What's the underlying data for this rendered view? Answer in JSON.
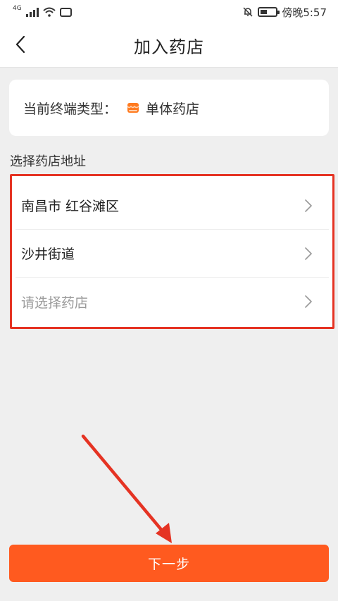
{
  "status_bar": {
    "network_label": "4G",
    "time_text": "傍晚5:57",
    "battery_level": 0.45,
    "icons": [
      "signal-icon",
      "wifi-icon",
      "app-notification-icon",
      "bell-off-icon",
      "battery-icon"
    ]
  },
  "nav": {
    "title": "加入药店",
    "back_icon": "chevron-left-icon"
  },
  "terminal_type": {
    "label": "当前终端类型：",
    "value": "单体药店",
    "icon": "store-icon",
    "icon_color": "#ff7a1f"
  },
  "address_section": {
    "label": "选择药店地址",
    "highlight_color": "#e53323",
    "rows": [
      {
        "label": "南昌市 红谷滩区",
        "is_placeholder": false
      },
      {
        "label": "沙井街道",
        "is_placeholder": false
      },
      {
        "label": "请选择药店",
        "is_placeholder": true
      }
    ]
  },
  "annotation": {
    "arrow_color": "#e53323"
  },
  "footer": {
    "next_label": "下一步",
    "next_color": "#ff5a1f"
  }
}
